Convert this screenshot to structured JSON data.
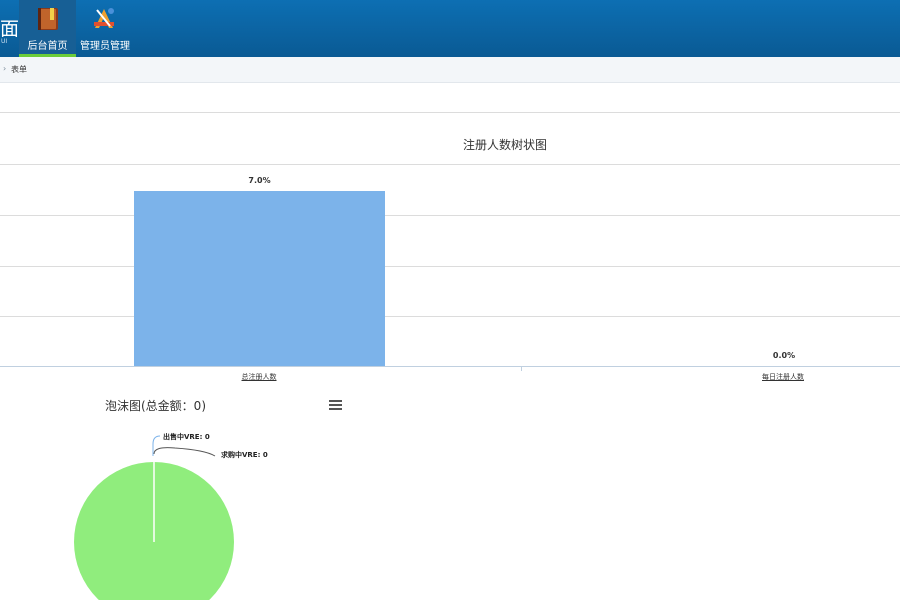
{
  "header": {
    "brand_text": "面",
    "brand_sub": "UI",
    "nav": [
      {
        "label": "后台首页",
        "icon": "book-icon",
        "active": true
      },
      {
        "label": "管理员管理",
        "icon": "admin-tools-icon",
        "active": false
      }
    ]
  },
  "breadcrumb": {
    "current": "表单"
  },
  "colors": {
    "header": "#0d6fb3",
    "active_underline": "#6ccc3a",
    "bar": "#7cb3ea",
    "pie": "#90ed7d"
  },
  "chart_data": [
    {
      "type": "bar",
      "title": "注册人数树状图",
      "categories": [
        "总注册人数",
        "每日注册人数"
      ],
      "values": [
        7.0,
        0.0
      ],
      "data_labels": [
        "7.0%",
        "0.0%"
      ],
      "ylim": [
        0,
        8
      ],
      "grid": true,
      "legend": false
    },
    {
      "type": "pie",
      "title": "泡沫图(总金额：0)",
      "categories": [
        "出售中VRE",
        "求购中VRE"
      ],
      "values": [
        0,
        0
      ],
      "data_labels": [
        "出售中VRE: 0",
        "求购中VRE: 0"
      ]
    }
  ]
}
